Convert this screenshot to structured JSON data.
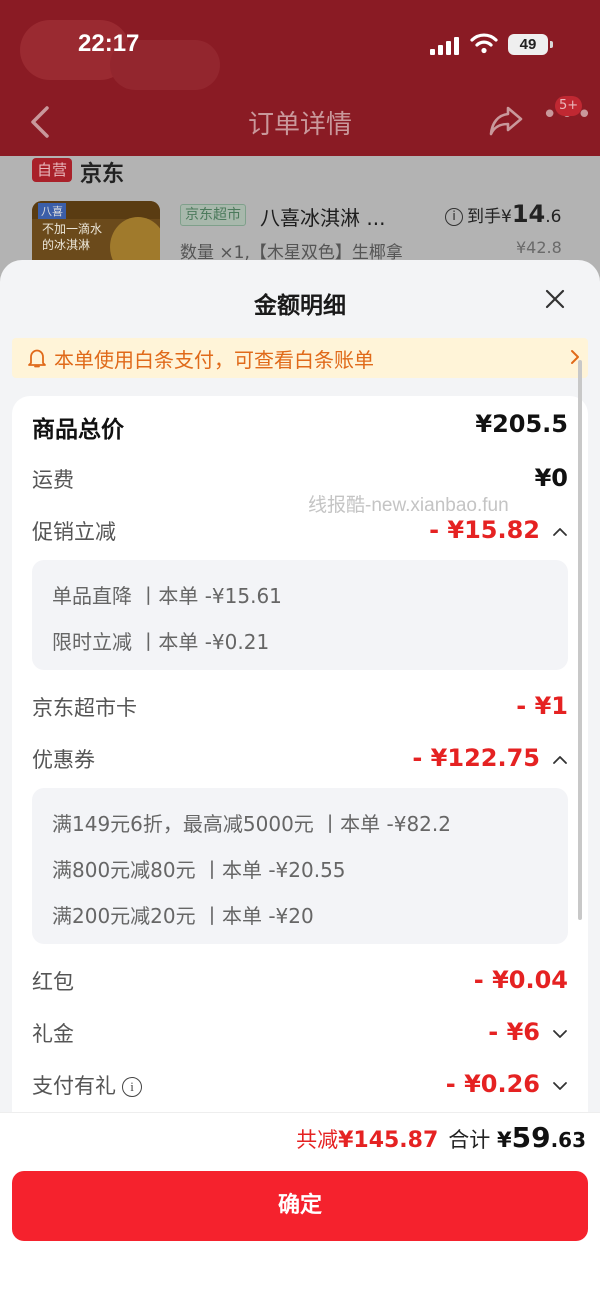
{
  "status_bar": {
    "time": "22:17",
    "battery": "49"
  },
  "nav": {
    "title": "订单详情",
    "badge": "5+"
  },
  "store": {
    "tag": "自营",
    "name": "京东"
  },
  "product": {
    "image_text": "不加一滴水的冰淇淋",
    "image_brand": "八喜",
    "market_tag": "京东超市",
    "title": "八喜冰淇淋 ...",
    "spec": "数量 ×1,【木星双色】生椰拿",
    "price_prefix": "到手",
    "price_symbol": "¥",
    "price_int": "14",
    "price_dec": ".6",
    "original_price": "¥42.8"
  },
  "sheet": {
    "title": "金额明细",
    "notice": "本单使用白条支付，可查看白条账单",
    "watermark": "线报酷-new.xianbao.fun",
    "rows": {
      "total": {
        "label": "商品总价",
        "value": "¥205.5"
      },
      "shipping": {
        "label": "运费",
        "value": "¥0"
      },
      "promo": {
        "label": "促销立减",
        "value": "- ¥15.82"
      },
      "jd_card": {
        "label": "京东超市卡",
        "value": "- ¥1"
      },
      "coupon": {
        "label": "优惠券",
        "value": "- ¥122.75"
      },
      "red_packet": {
        "label": "红包",
        "value": "- ¥0.04"
      },
      "gift": {
        "label": "礼金",
        "value": "- ¥6"
      },
      "pay_gift": {
        "label": "支付有礼",
        "value": "- ¥0.26"
      }
    },
    "promo_details": [
      "单品直降 丨本单 -¥15.61",
      "限时立减 丨本单 -¥0.21"
    ],
    "coupon_details": [
      "满149元6折，最高减5000元 丨本单 -¥82.2",
      "满800元减80元 丨本单 -¥20.55",
      "满200元减20元 丨本单 -¥20"
    ]
  },
  "footer": {
    "discount_label": "共减",
    "discount_value": "¥145.87",
    "total_label": "合计",
    "total_symbol": "¥",
    "total_int": "59",
    "total_dec": ".63",
    "confirm": "确定"
  },
  "colors": {
    "accent": "#f5222d",
    "discount": "#e52222",
    "notice": "#e06a1a"
  }
}
